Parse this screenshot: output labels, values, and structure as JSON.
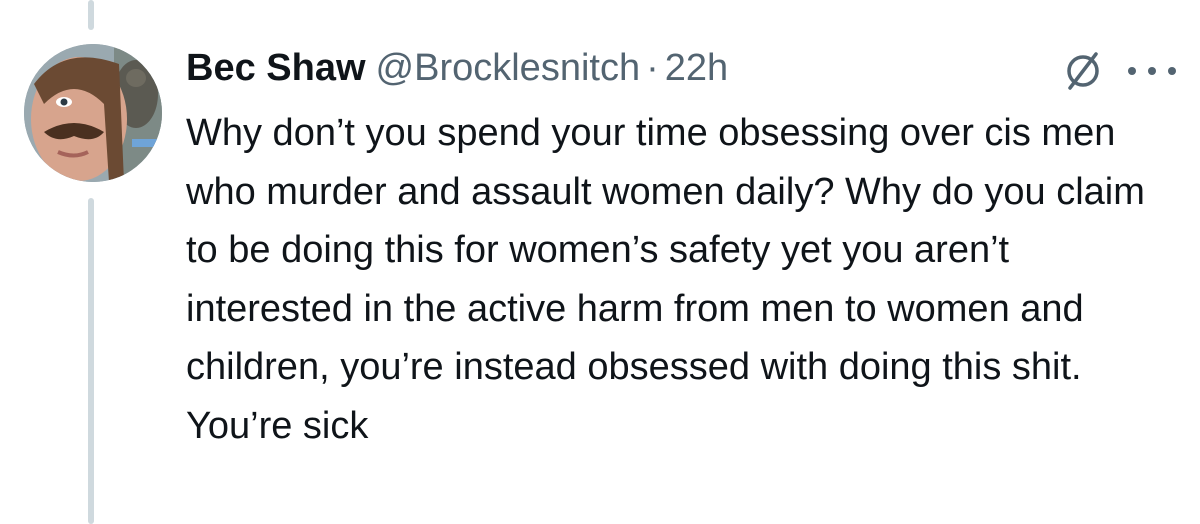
{
  "tweet": {
    "display_name": "Bec Shaw",
    "handle": "@Brocklesnitch",
    "separator": "·",
    "time": "22h",
    "text": "Why don’t you spend your time obsessing over cis men who murder and assault women daily? Why do you claim to be doing this for women’s safety yet you aren’t interested in the active harm from men to women and children, you’re instead obsessed with doing this shit. You’re sick"
  },
  "icons": {
    "hidden_reply": "hidden-replies-icon",
    "more": "more-options-icon"
  },
  "colors": {
    "text_primary": "#0f1419",
    "text_secondary": "#536471",
    "thread_line": "#cfd9de",
    "background": "#ffffff"
  }
}
